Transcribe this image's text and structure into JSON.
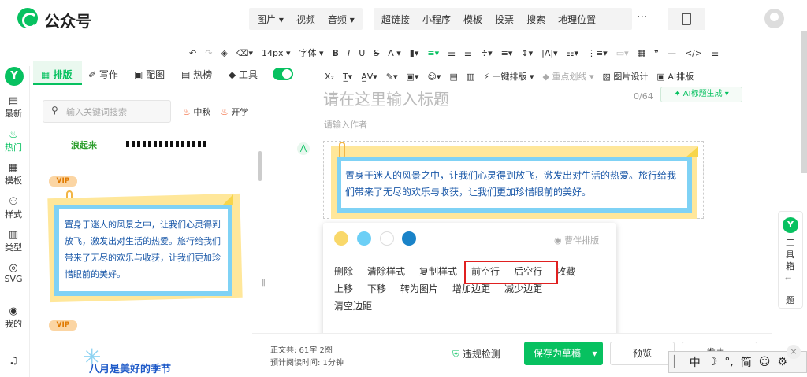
{
  "header": {
    "app_name": "公众号",
    "insert_menu": [
      "图片",
      "视频",
      "音频"
    ],
    "insert_menu2": [
      "超链接",
      "小程序",
      "模板",
      "投票",
      "搜索",
      "地理位置"
    ],
    "more": "···"
  },
  "toolbar1": {
    "font_size": "14px",
    "font_family": "字体"
  },
  "toolbar2": {
    "one_click": "一键排版",
    "highlight": "重点划线",
    "image_design": "图片设计",
    "ai_layout": "AI排版"
  },
  "left_rail": [
    {
      "label": "最新",
      "icon": "newspaper-icon"
    },
    {
      "label": "热门",
      "icon": "fire-icon",
      "active": true
    },
    {
      "label": "模板",
      "icon": "template-icon"
    },
    {
      "label": "样式",
      "icon": "palette-icon"
    },
    {
      "label": "类型",
      "icon": "columns-icon"
    },
    {
      "label": "SVG",
      "icon": "svg-icon"
    },
    {
      "label": "我的",
      "icon": "user-icon"
    }
  ],
  "panel": {
    "tabs": [
      "排版",
      "写作",
      "配图",
      "热榜",
      "工具"
    ],
    "search_placeholder": "输入关键词搜索",
    "tags": [
      "中秋",
      "开学"
    ],
    "strip_text": "浪起来",
    "vip_label": "VIP",
    "card_text": "置身于迷人的风景之中，让我们心灵得到放飞，激发出对生活的热爱。旅行给我们带来了无尽的欢乐与收获，让我们更加珍惜眼前的美好。",
    "bottom_card_text": "八月是美好的季节"
  },
  "editor": {
    "title_placeholder": "请在这里输入标题",
    "title_count": "0/64",
    "ai_title": "AI标题生成",
    "author_placeholder": "请输入作者",
    "content": "置身于迷人的风景之中，让我们心灵得到放飞，激发出对生活的热爱。旅行给我们带来了无尽的欢乐与收获，让我们更加珍惜眼前的美好。"
  },
  "popup": {
    "colors": [
      "#f9d86a",
      "#6ccff6",
      "#ffffff",
      "#1a83c8"
    ],
    "lock": "曹伴排版",
    "menu": [
      "删除",
      "清除样式",
      "复制样式",
      "前空行",
      "后空行",
      "收藏",
      "上移",
      "下移",
      "转为图片",
      "增加边距",
      "减少边距",
      "清空边距"
    ]
  },
  "footer": {
    "word_count": "正文共: 61字 2图",
    "read_time": "预计阅读时间: 1分钟",
    "check": "违规检测",
    "save": "保存为草稿",
    "preview": "预览",
    "publish": "发表"
  },
  "ime": {
    "mode": "中",
    "punct": "°,",
    "script": "简"
  },
  "right_tool": {
    "label": "工具箱",
    "sub": "题"
  }
}
